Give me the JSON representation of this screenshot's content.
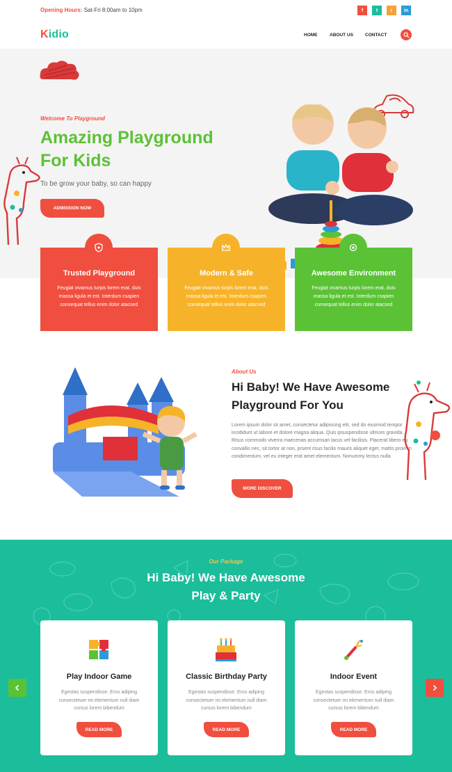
{
  "topbar": {
    "hours_label": "Opening Hours:",
    "hours_value": "Sat-Fri 8:00am to 10pm",
    "social": [
      {
        "icon": "facebook-icon",
        "glyph": "f",
        "color": "#f04e3e"
      },
      {
        "icon": "twitter-icon",
        "glyph": "t",
        "color": "#1cbd9b"
      },
      {
        "icon": "rss-icon",
        "glyph": "r",
        "color": "#f6a13a"
      },
      {
        "icon": "linkedin-icon",
        "glyph": "in",
        "color": "#2b9bd6"
      }
    ]
  },
  "header": {
    "logo_first": "K",
    "logo_rest": "idio",
    "nav": [
      "HOME",
      "ABOUT US",
      "CONTACT"
    ]
  },
  "hero": {
    "tag": "Welcome To Playground",
    "title_line1": "Amazing Playground",
    "title_line2": "For Kids",
    "subtitle": "To be grow your baby, so can happy",
    "button": "ADMISSION NOW"
  },
  "features": [
    {
      "title": "Trusted Playground",
      "text": "Feugiat vivamus turpis lorem erat, duis massa ligula et est. Interdum csapien consequat tellus enim dolor atacsed",
      "color": "#f04e3e",
      "icon": "shield-icon"
    },
    {
      "title": "Modern & Safe",
      "text": "Feugiat vivamus turpis lorem erat, duis massa ligula et est. Interdum csapien consequat tellus enim dolor atacsed",
      "color": "#f6b32a",
      "icon": "crown-icon"
    },
    {
      "title": "Awesome Environment",
      "text": "Feugiat vivamus turpis lorem erat, duis massa ligula et est. Interdum csapien consequat tellus enim dolor atacsed",
      "color": "#5bc236",
      "icon": "gear-icon"
    }
  ],
  "about": {
    "tag": "About Us",
    "title_line1": "Hi Baby! We Have Awesome",
    "title_line2": "Playground For You",
    "text": "Lorem ipsum dolor sit amet, consectetur adipiscing elit, sed do eiusmod tempor incididunt ut labore et dolore magna aliqua. Quis ipsuspendisse ultrices gravida. Risus commodo viverra maecenas accumsan lacus vel facilisis. Placerat libero eu convallis nec, sit tortor at non, prsent risus facilis mauris aliquet eget, mattis proin in condimentum, vel eu integer erat amet elementum. Nonummy lectus nulla",
    "button": "MORE DISCOVER"
  },
  "package": {
    "tag": "Our Package",
    "title_line1": "Hi Baby! We Have Awesome",
    "title_line2": "Play & Party",
    "cards": [
      {
        "title": "Play Indoor Game",
        "text": "Egestas suspendisse. Eros adiping consectetuer mi elementum null diam cursus lorem bibendum",
        "button": "READ MORE",
        "icon": "puzzle-icon"
      },
      {
        "title": "Classic Birthday Party",
        "text": "Egestas suspendisse. Eros adiping consectetuer mi elementum null diam cursus lorem bibendum",
        "button": "READ MORE",
        "icon": "cake-icon"
      },
      {
        "title": "Indoor Event",
        "text": "Egestas suspendisse. Eros adiping consectetuer mi elementum null diam cursus lorem bibendum",
        "button": "READ MORE",
        "icon": "firework-icon"
      }
    ],
    "prev_icon": "chevron-left-icon",
    "next_icon": "chevron-right-icon"
  },
  "colors": {
    "red": "#f04e3e",
    "teal": "#1cbd9b",
    "green": "#5bc236",
    "yellow": "#f6b32a"
  }
}
